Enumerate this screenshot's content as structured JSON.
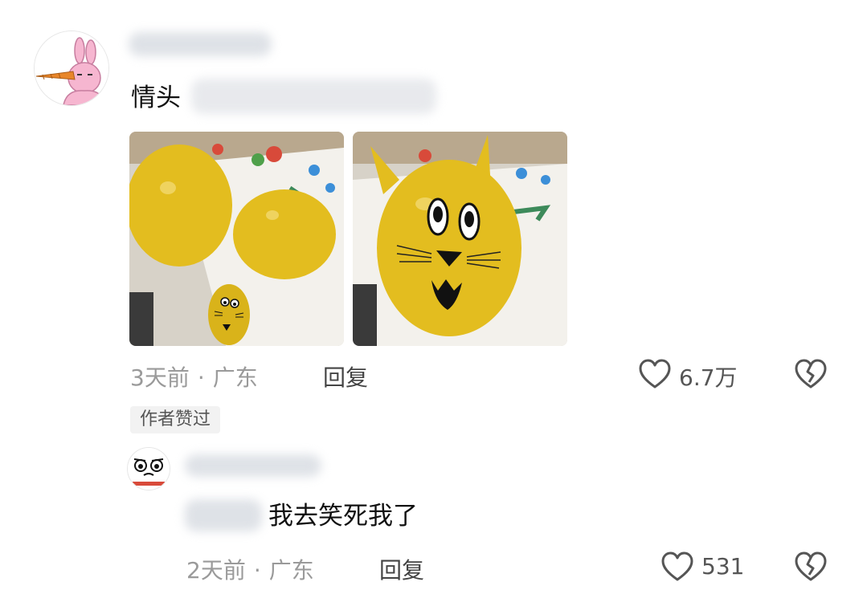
{
  "comment": {
    "text_prefix": "情头",
    "time": "3天前",
    "location": "广东",
    "reply_label": "回复",
    "like_count": "6.7万",
    "author_badge": "作者赞过"
  },
  "reply": {
    "text": "我去笑死我了",
    "time": "2天前",
    "location": "广东",
    "reply_label": "回复",
    "like_count": "531"
  },
  "separator": "·",
  "colors": {
    "meta_gray": "#9a9a9a",
    "balloon_yellow": "#e8c41e"
  }
}
